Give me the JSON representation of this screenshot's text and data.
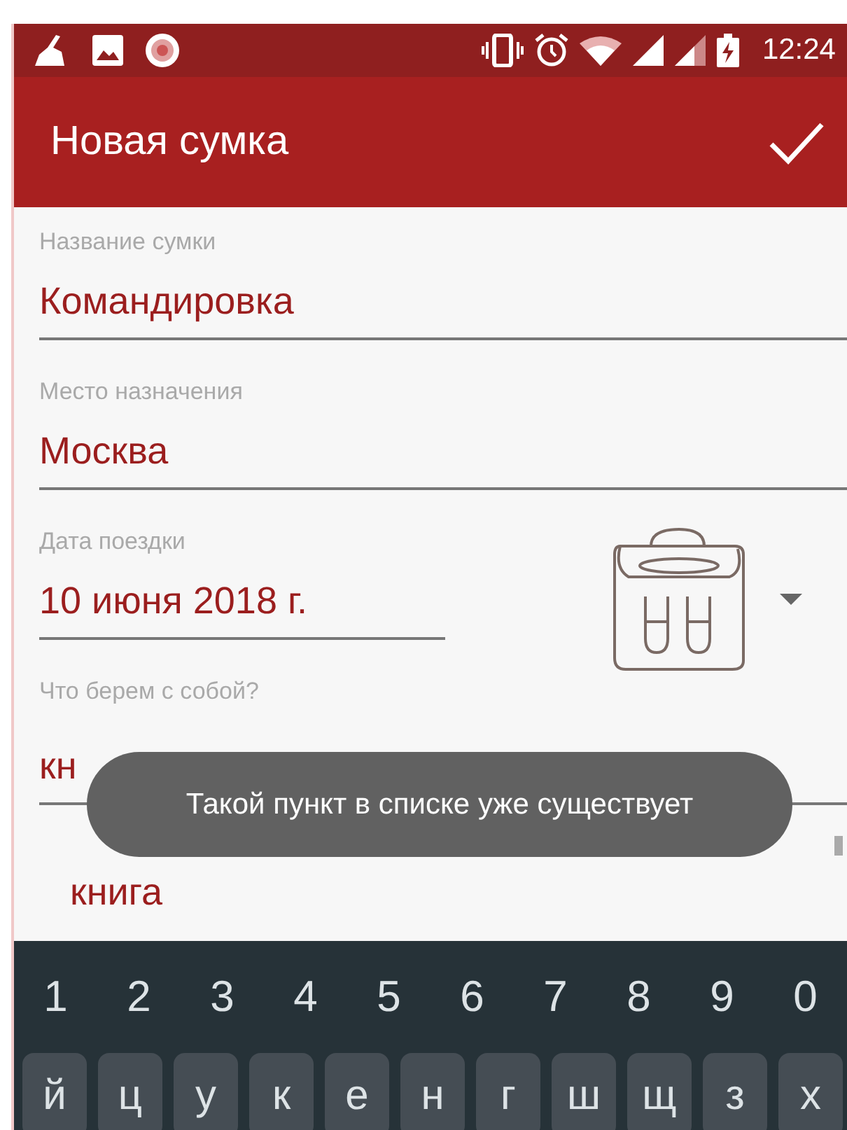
{
  "status_bar": {
    "time": "12:24"
  },
  "app_bar": {
    "title": "Новая сумка"
  },
  "fields": [
    {
      "label": "Название сумки",
      "value": "Командировка"
    },
    {
      "label": "Место назначения",
      "value": "Москва"
    }
  ],
  "date_field": {
    "label": "Дата поездки",
    "value": "10 июня 2018 г."
  },
  "item_field": {
    "label": "Что берем с собой?",
    "value": "кн"
  },
  "toast": "Такой пункт в списке уже существует",
  "items": [
    "книга"
  ],
  "keyboard": {
    "number_row": [
      "1",
      "2",
      "3",
      "4",
      "5",
      "6",
      "7",
      "8",
      "9",
      "0"
    ],
    "letter_row": [
      "й",
      "ц",
      "у",
      "к",
      "е",
      "н",
      "г",
      "ш",
      "щ",
      "з",
      "х"
    ]
  }
}
